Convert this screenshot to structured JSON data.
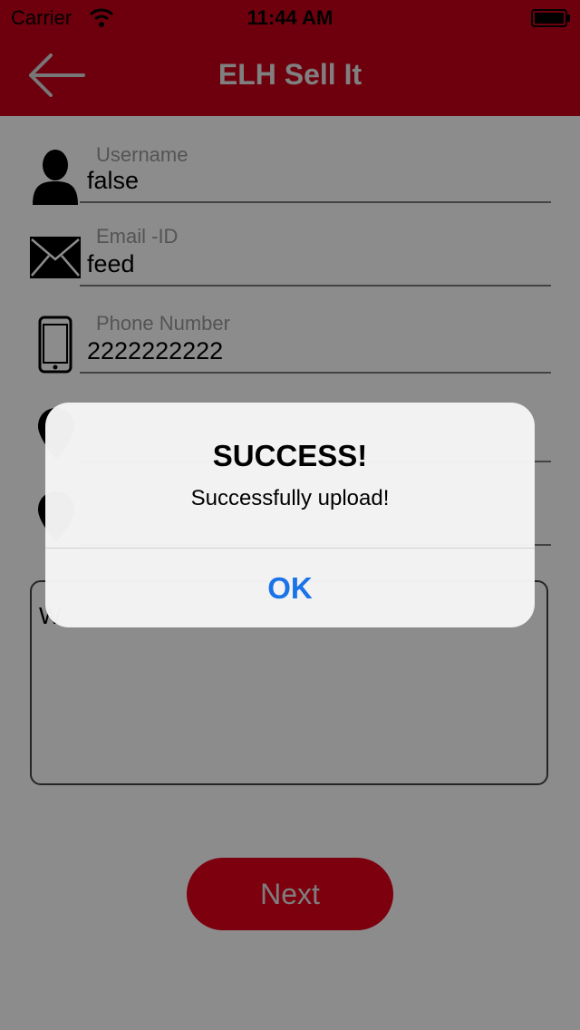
{
  "status_bar": {
    "carrier": "Carrier",
    "time": "11:44 AM"
  },
  "nav": {
    "title": "ELH Sell It",
    "back_icon": "arrow-left-icon"
  },
  "form": {
    "username": {
      "label": "Username",
      "value": "false",
      "icon": "person-icon"
    },
    "email": {
      "label": "Email -ID",
      "value": "feed",
      "icon": "envelope-icon"
    },
    "phone": {
      "label": "Phone Number",
      "value": "2222222222",
      "icon": "phone-icon"
    },
    "description": {
      "visible_text": "W"
    }
  },
  "next_button": {
    "label": "Next"
  },
  "alert": {
    "title": "SUCCESS!",
    "message": "Successfully upload!",
    "button": "OK"
  },
  "colors": {
    "header": "#c8001a",
    "next_button": "#e2001b",
    "alert_button": "#1a73e8"
  }
}
